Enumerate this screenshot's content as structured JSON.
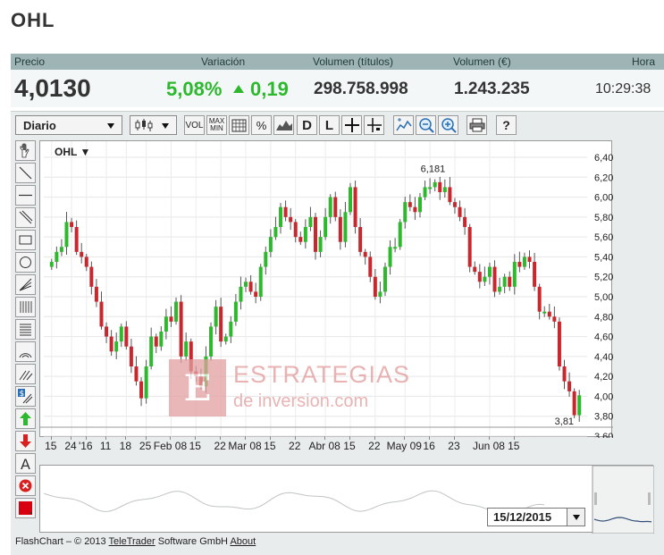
{
  "title": "OHL",
  "quote": {
    "headers": [
      "Precio",
      "Variación",
      "Volumen (títulos)",
      "Volumen (€)",
      "Hora"
    ],
    "price": "4,0130",
    "pct": "5,08%",
    "change": "0,19",
    "vol_titulos": "298.758.998",
    "vol_eur": "1.243.235",
    "time": "10:29:38"
  },
  "toolbar": {
    "period": "Diario",
    "buttons": [
      "VOL",
      "MAX MIN",
      "%",
      "D",
      "L"
    ]
  },
  "side_tools": [
    "hand-tool",
    "line-tool",
    "hline-tool",
    "channel-tool",
    "rect-tool",
    "circle-tool",
    "fan-tool",
    "fib-tool",
    "grid-tool",
    "arc-tool",
    "pitchfork-tool",
    "dollar-tool",
    "buy-arrow",
    "sell-arrow",
    "text-tool",
    "delete-tool",
    "color-picker"
  ],
  "side_labels": {
    "text": "A",
    "dollar": "$"
  },
  "chart_data": {
    "type": "candlestick",
    "instrument": "OHL",
    "ylim": [
      3.6,
      6.4
    ],
    "y_ticks": [
      "6,400",
      "6,200",
      "6,000",
      "5,800",
      "5,600",
      "5,400",
      "5,200",
      "5,000",
      "4,800",
      "4,600",
      "4,400",
      "4,200",
      "4,000",
      "3,800",
      "3,600"
    ],
    "x_ticks": [
      "15",
      "24",
      "'16",
      "11",
      "18",
      "25",
      "Feb 08",
      "15",
      "22",
      "Mar 08",
      "15",
      "22",
      "Abr 08",
      "15",
      "22",
      "May 09",
      "16",
      "23",
      "Jun 08",
      "15"
    ],
    "max_label": "6,181",
    "min_label": "3,81",
    "close_series": [
      5.35,
      5.45,
      5.5,
      5.75,
      5.7,
      5.45,
      5.4,
      5.3,
      5.1,
      4.95,
      4.7,
      4.6,
      4.45,
      4.55,
      4.7,
      4.5,
      4.3,
      4.15,
      3.98,
      4.3,
      4.6,
      4.5,
      4.65,
      4.8,
      4.75,
      4.95,
      4.4,
      4.55,
      4.25,
      4.2,
      4.1,
      4.4,
      4.7,
      4.9,
      4.55,
      4.6,
      4.75,
      4.95,
      5.1,
      5.15,
      5.05,
      5.0,
      5.3,
      5.45,
      5.6,
      5.7,
      5.9,
      5.8,
      5.75,
      5.6,
      5.55,
      5.7,
      5.8,
      5.45,
      5.6,
      5.8,
      6.0,
      5.8,
      5.55,
      5.85,
      6.1,
      5.7,
      5.45,
      5.4,
      5.2,
      5.0,
      5.05,
      5.3,
      5.5,
      5.5,
      5.75,
      5.95,
      5.9,
      5.85,
      6.0,
      6.1,
      6.1,
      6.15,
      6.05,
      6.1,
      5.95,
      5.9,
      5.8,
      5.7,
      5.3,
      5.25,
      5.15,
      5.2,
      5.3,
      5.05,
      5.1,
      5.2,
      5.1,
      5.35,
      5.3,
      5.4,
      5.35,
      5.1,
      4.85,
      4.85,
      4.8,
      4.75,
      4.3,
      4.15,
      4.05,
      3.81,
      4.01
    ],
    "nav_date": "15/12/2015"
  },
  "footer": {
    "prefix": "FlashChart – © 2013 ",
    "link1": "TeleTrader",
    "middle": " Software GmbH ",
    "link2": "About"
  },
  "watermark": {
    "logo": "E",
    "line1": "ESTRATEGIAS",
    "line2": "de inversion.com"
  },
  "colors": {
    "up": "#2db82d",
    "down": "#c8282d",
    "header": "#9fb4b4"
  }
}
